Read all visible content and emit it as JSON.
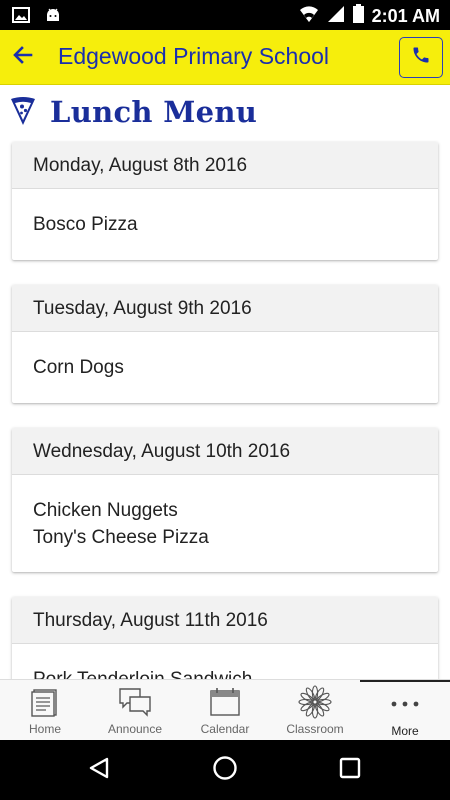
{
  "status_bar": {
    "time": "2:01 AM",
    "icons": [
      "image-icon",
      "android-icon",
      "wifi-icon",
      "signal-icon",
      "battery-icon"
    ]
  },
  "app_bar": {
    "title": "Edgewood Primary School",
    "back_icon": "arrow-left-icon",
    "call_icon": "phone-icon",
    "background": "#f6ee0c",
    "accent": "#1a2fae"
  },
  "page": {
    "icon": "pizza-icon",
    "title": "Lunch Menu"
  },
  "menu_days": [
    {
      "date": "Monday, August 8th 2016",
      "items": [
        "Bosco Pizza"
      ]
    },
    {
      "date": "Tuesday, August 9th 2016",
      "items": [
        "Corn Dogs"
      ]
    },
    {
      "date": "Wednesday, August 10th 2016",
      "items": [
        "Chicken Nuggets",
        "Tony's Cheese Pizza"
      ]
    },
    {
      "date": "Thursday, August 11th 2016",
      "items": [
        "Pork Tenderloin Sandwich"
      ]
    }
  ],
  "bottom_nav": [
    {
      "label": "Home",
      "icon": "document-icon",
      "active": false
    },
    {
      "label": "Announce",
      "icon": "chat-bubbles-icon",
      "active": false
    },
    {
      "label": "Calendar",
      "icon": "calendar-icon",
      "active": false
    },
    {
      "label": "Classroom",
      "icon": "flower-icon",
      "active": false
    },
    {
      "label": "More",
      "icon": "more-dots-icon",
      "active": true
    }
  ],
  "system_nav": [
    "back-triangle-icon",
    "home-circle-icon",
    "recents-square-icon"
  ]
}
